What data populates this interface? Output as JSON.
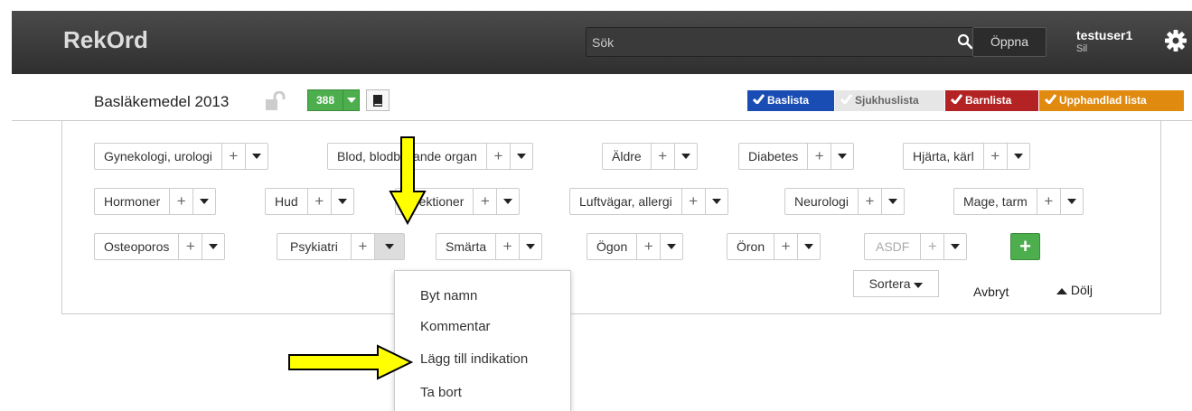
{
  "header": {
    "brand": "RekOrd",
    "search_placeholder": "Sök",
    "open_label": "Öppna",
    "username": "testuser1",
    "user_sub": "Sil"
  },
  "subheader": {
    "list_name": "Basläkemedel 2013",
    "count": "388",
    "tags": [
      {
        "label": "Baslista",
        "color": "#1a4db3"
      },
      {
        "label": "Sjukhuslista",
        "color": "#e6e6e6"
      },
      {
        "label": "Barnlista",
        "color": "#b42323"
      },
      {
        "label": "Upphandlad lista",
        "color": "#e08a10"
      }
    ]
  },
  "groups": {
    "row1": [
      "Gynekologi, urologi",
      "Blod, blodbildande organ",
      "Äldre",
      "Diabetes",
      "Hjärta, kärl"
    ],
    "row2": [
      "Hormoner",
      "Hud",
      "Infektioner",
      "Luftvägar, allergi",
      "Neurologi",
      "Mage, tarm"
    ],
    "row3": [
      "Osteoporos",
      "Psykiatri",
      "Smärta",
      "Ögon",
      "Öron",
      "ASDF"
    ],
    "plus": "+",
    "add": "+"
  },
  "actions": {
    "sort": "Sortera",
    "cancel": "Avbryt",
    "hide": "Dölj"
  },
  "menu": {
    "items": [
      "Byt namn",
      "Kommentar",
      "Lägg till indikation",
      "Ta bort"
    ]
  },
  "colors": {
    "green": "#4cae4c",
    "arrow_yellow": "#ffff00"
  }
}
